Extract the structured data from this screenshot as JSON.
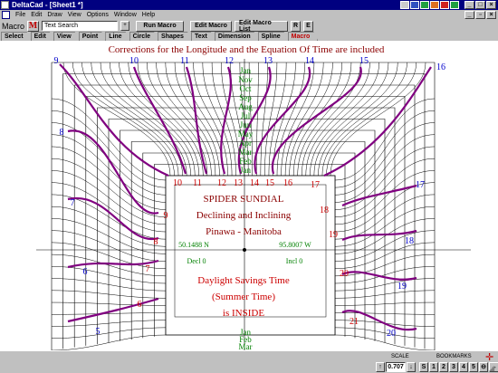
{
  "window": {
    "title": "DeltaCad - [Sheet1 *]"
  },
  "menu": [
    "File",
    "Edit",
    "Draw",
    "View",
    "Options",
    "Window",
    "Help"
  ],
  "toolbar": {
    "macro_label": "Macro",
    "macro_icon": "M",
    "search_value": "Text Search",
    "dropdown_glyph": "+",
    "buttons": [
      "Run Macro",
      "Edit Macro",
      "Edit Macro List",
      "R",
      "E"
    ]
  },
  "tabs": [
    "Select",
    "Edit",
    "View",
    "Point",
    "Line",
    "Circle",
    "Shapes",
    "Text",
    "Dimension",
    "Spline",
    "Macro"
  ],
  "active_tab": "Macro",
  "drawing": {
    "header": "Corrections for the Longitude and the Equation Of Time are included",
    "title_lines": [
      "SPIDER SUNDIAL",
      "Declining and Inclining",
      "Pinawa - Manitoba"
    ],
    "latitude": "50.1488 N",
    "longitude": "95.8007 W",
    "decl": "Decl 0",
    "incl": "Incl 0",
    "dst_lines": [
      "Daylight Savings Time",
      "(Summer Time)",
      "is INSIDE"
    ],
    "outer_hour_labels": [
      "9",
      "10",
      "11",
      "12",
      "13",
      "14",
      "15",
      "16",
      "8",
      "7",
      "6",
      "5",
      "17",
      "18",
      "19",
      "20"
    ],
    "inner_hour_labels": [
      "10",
      "11",
      "12",
      "13",
      "14",
      "15",
      "16",
      "17",
      "18",
      "9",
      "8",
      "7",
      "6",
      "19",
      "20",
      "21"
    ],
    "date_labels_top": [
      "Jan",
      "Nov",
      "Oct",
      "Sep",
      "Aug",
      "Jul",
      "Jun",
      "May",
      "Apr",
      "Mar",
      "Feb",
      "Jan"
    ],
    "date_labels_bottom": [
      "Jan",
      "Feb",
      "Mar"
    ],
    "colors": {
      "outer_label": "#0000cc",
      "inner_label": "#cc0000",
      "hour_curve": "#800080",
      "date_label": "#008000",
      "header": "#8b0000"
    }
  },
  "status": {
    "scale_label": "SCALE",
    "bookmarks_label": "BOOKMARKS",
    "scale_up": "↑",
    "scale_value": "0.707",
    "scale_down": "↓",
    "bookmarks": [
      "S",
      "1",
      "2",
      "3",
      "4",
      "5"
    ],
    "minus": "⊖",
    "arrow": "→"
  }
}
